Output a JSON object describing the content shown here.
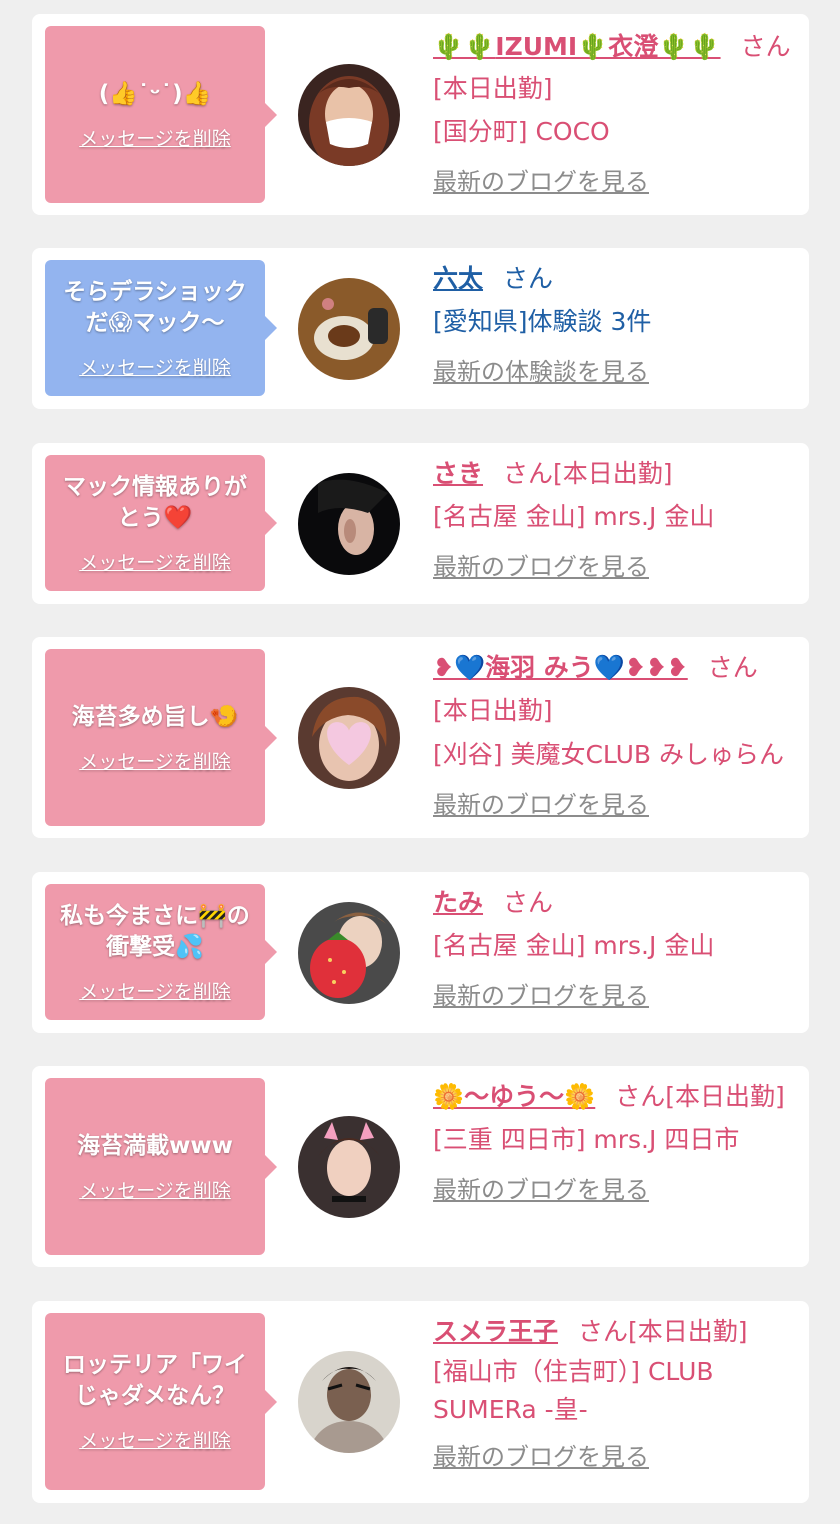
{
  "theme": {
    "pink_text": "#d94f74",
    "blue_text": "#1f5fa5",
    "pink_bubble": "#ef9aab",
    "blue_bubble": "#93b4ef",
    "link_gray": "#8c8c8c",
    "page_bg": "#efefef"
  },
  "cards": [
    {
      "bubble_color": "pink",
      "message": "(👍˙ᵕ˙)👍",
      "delete_label": "メッセージを削除",
      "name_prefix": "🌵🌵",
      "name": "IZUMI🌵衣澄🌵🌵",
      "name_suffix": "さん[本日出勤]",
      "detail": "[国分町] COCO",
      "link": "最新のブログを見る"
    },
    {
      "bubble_color": "blue",
      "message": "そらデラショックだ😱マック〜",
      "delete_label": "メッセージを削除",
      "name": "六太",
      "name_suffix": "さん",
      "detail": "[愛知県]体験談 3件",
      "link": "最新の体験談を見る"
    },
    {
      "bubble_color": "pink",
      "message": "マック情報ありがとう❤️",
      "delete_label": "メッセージを削除",
      "name": "さき",
      "name_suffix": "さん[本日出勤]",
      "detail": "[名古屋 金山] mrs.J 金山",
      "link": "最新のブログを見る"
    },
    {
      "bubble_color": "pink",
      "message": "海苔多め旨し🍤",
      "delete_label": "メッセージを削除",
      "name": "❥💙海羽 みう💙❥❥❥",
      "name_suffix": "さん",
      "detail_line1": "[本日出勤]",
      "detail": "[刈谷] 美魔女CLUB みしゅらん",
      "link": "最新のブログを見る"
    },
    {
      "bubble_color": "pink",
      "message": "私も今まさに🚧の衝撃受💦",
      "delete_label": "メッセージを削除",
      "name": "たみ",
      "name_suffix": "さん",
      "detail": "[名古屋 金山] mrs.J 金山",
      "link": "最新のブログを見る"
    },
    {
      "bubble_color": "pink",
      "message": "海苔満載www",
      "delete_label": "メッセージを削除",
      "name": "🌼〜ゆう〜🌼",
      "name_suffix": "さん[本日出勤]",
      "detail": "[三重 四日市] mrs.J 四日市",
      "link": "最新のブログを見る"
    },
    {
      "bubble_color": "pink",
      "message": "ロッテリア「ワイじゃダメなん？",
      "delete_label": "メッセージを削除",
      "name": "スメラ王子",
      "name_suffix": "さん[本日出勤]",
      "detail": "[福山市（住吉町）] CLUB SUMERa -皇-",
      "link": "最新のブログを見る"
    }
  ]
}
